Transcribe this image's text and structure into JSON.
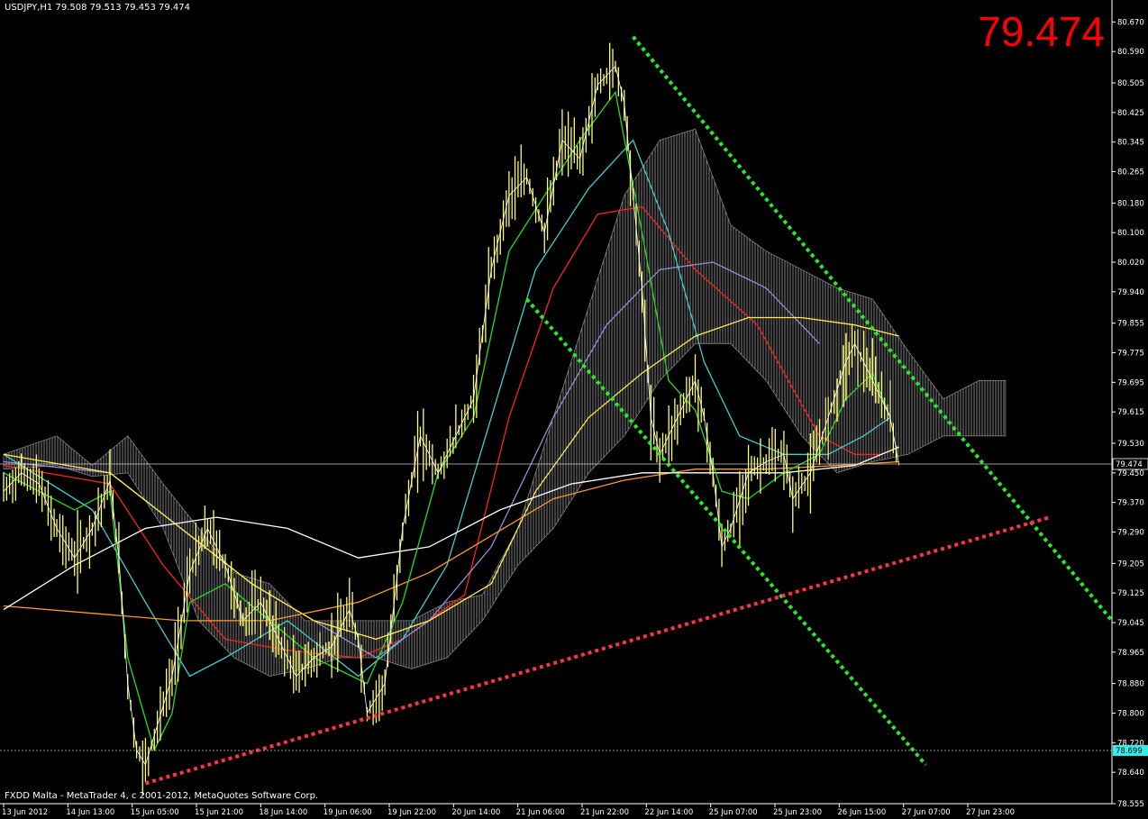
{
  "header": {
    "symbol_info": "USDJPY,H1  79.508 79.513 79.453 79.474",
    "big_price": "79.474",
    "copyright": "FXDD Malta - MetaTrader 4, c 2001-2012, MetaQuotes Software Corp."
  },
  "colors": {
    "background": "#000000",
    "candle": "#ffff66",
    "axis": "#ffffff",
    "trend_green": "#22ee22",
    "trend_red": "#ff3344",
    "big_price": "#ff0000",
    "ma_red": "#ff2020",
    "ma_blue": "#9a8ad8",
    "ma_cyan": "#3cd0d0",
    "ma_yellow": "#ffee44",
    "ma_orange": "#ff9a2a",
    "ma_white": "#ffffff",
    "ma_green": "#22dd22",
    "cloud": "#9a9a9a",
    "price_marker_bg": "#33eeee"
  },
  "chart_data": {
    "type": "line",
    "title": "USDJPY,H1",
    "y_axis_position": "right",
    "ylim": [
      78.555,
      80.705
    ],
    "y_ticks": [
      "80.670",
      "80.590",
      "80.505",
      "80.425",
      "80.345",
      "80.265",
      "80.180",
      "80.100",
      "80.020",
      "79.940",
      "79.855",
      "79.775",
      "79.695",
      "79.615",
      "79.530",
      "79.450",
      "79.370",
      "79.290",
      "79.205",
      "79.125",
      "79.045",
      "78.965",
      "78.880",
      "78.800",
      "78.720",
      "78.640",
      "78.555"
    ],
    "x_ticks": [
      "13 Jun 2012",
      "14 Jun 13:00",
      "15 Jun 05:00",
      "15 Jun 21:00",
      "18 Jun 14:00",
      "19 Jun 06:00",
      "19 Jun 22:00",
      "20 Jun 14:00",
      "21 Jun 06:00",
      "21 Jun 22:00",
      "22 Jun 14:00",
      "25 Jun 07:00",
      "25 Jun 23:00",
      "26 Jun 15:00",
      "27 Jun 07:00",
      "27 Jun 23:00"
    ],
    "x_index_range": [
      0,
      125
    ],
    "current_price": {
      "value": 79.474,
      "label": "79.474"
    },
    "marker_price": {
      "value": 78.699,
      "label": "78.699"
    },
    "price_close": [
      {
        "i": 0,
        "v": 79.4
      },
      {
        "i": 2,
        "v": 79.45
      },
      {
        "i": 4,
        "v": 79.42
      },
      {
        "i": 6,
        "v": 79.3
      },
      {
        "i": 8,
        "v": 79.22
      },
      {
        "i": 10,
        "v": 79.3
      },
      {
        "i": 12,
        "v": 79.43
      },
      {
        "i": 13,
        "v": 79.22
      },
      {
        "i": 14,
        "v": 78.88
      },
      {
        "i": 15,
        "v": 78.7
      },
      {
        "i": 16,
        "v": 78.66
      },
      {
        "i": 17,
        "v": 78.74
      },
      {
        "i": 19,
        "v": 78.9
      },
      {
        "i": 21,
        "v": 79.18
      },
      {
        "i": 23,
        "v": 79.3
      },
      {
        "i": 25,
        "v": 79.2
      },
      {
        "i": 27,
        "v": 79.05
      },
      {
        "i": 29,
        "v": 79.1
      },
      {
        "i": 31,
        "v": 79.0
      },
      {
        "i": 33,
        "v": 78.9
      },
      {
        "i": 35,
        "v": 78.95
      },
      {
        "i": 37,
        "v": 78.98
      },
      {
        "i": 39,
        "v": 79.08
      },
      {
        "i": 40,
        "v": 79.0
      },
      {
        "i": 41,
        "v": 78.8
      },
      {
        "i": 43,
        "v": 78.88
      },
      {
        "i": 45,
        "v": 79.3
      },
      {
        "i": 47,
        "v": 79.55
      },
      {
        "i": 49,
        "v": 79.45
      },
      {
        "i": 51,
        "v": 79.55
      },
      {
        "i": 53,
        "v": 79.65
      },
      {
        "i": 55,
        "v": 80.0
      },
      {
        "i": 57,
        "v": 80.2
      },
      {
        "i": 59,
        "v": 80.25
      },
      {
        "i": 61,
        "v": 80.1
      },
      {
        "i": 63,
        "v": 80.35
      },
      {
        "i": 65,
        "v": 80.3
      },
      {
        "i": 67,
        "v": 80.5
      },
      {
        "i": 69,
        "v": 80.55
      },
      {
        "i": 70,
        "v": 80.45
      },
      {
        "i": 71,
        "v": 80.2
      },
      {
        "i": 72,
        "v": 79.95
      },
      {
        "i": 73,
        "v": 79.6
      },
      {
        "i": 74,
        "v": 79.5
      },
      {
        "i": 76,
        "v": 79.6
      },
      {
        "i": 78,
        "v": 79.7
      },
      {
        "i": 79,
        "v": 79.6
      },
      {
        "i": 80,
        "v": 79.45
      },
      {
        "i": 81,
        "v": 79.25
      },
      {
        "i": 82,
        "v": 79.3
      },
      {
        "i": 84,
        "v": 79.45
      },
      {
        "i": 86,
        "v": 79.48
      },
      {
        "i": 88,
        "v": 79.5
      },
      {
        "i": 89,
        "v": 79.38
      },
      {
        "i": 91,
        "v": 79.45
      },
      {
        "i": 93,
        "v": 79.6
      },
      {
        "i": 95,
        "v": 79.75
      },
      {
        "i": 96,
        "v": 79.8
      },
      {
        "i": 98,
        "v": 79.7
      },
      {
        "i": 100,
        "v": 79.6
      },
      {
        "i": 101,
        "v": 79.47
      }
    ],
    "moving_averages": [
      {
        "color": "ma_red",
        "points": [
          {
            "i": 0,
            "v": 79.47
          },
          {
            "i": 12,
            "v": 79.42
          },
          {
            "i": 18,
            "v": 79.2
          },
          {
            "i": 25,
            "v": 79.0
          },
          {
            "i": 32,
            "v": 78.97
          },
          {
            "i": 40,
            "v": 78.95
          },
          {
            "i": 45,
            "v": 79.0
          },
          {
            "i": 52,
            "v": 79.12
          },
          {
            "i": 57,
            "v": 79.6
          },
          {
            "i": 62,
            "v": 79.95
          },
          {
            "i": 67,
            "v": 80.15
          },
          {
            "i": 72,
            "v": 80.17
          },
          {
            "i": 78,
            "v": 80.0
          },
          {
            "i": 85,
            "v": 79.85
          },
          {
            "i": 92,
            "v": 79.55
          },
          {
            "i": 96,
            "v": 79.5
          },
          {
            "i": 99,
            "v": 79.5
          }
        ]
      },
      {
        "color": "ma_blue",
        "points": [
          {
            "i": 0,
            "v": 79.48
          },
          {
            "i": 12,
            "v": 79.45
          },
          {
            "i": 20,
            "v": 79.3
          },
          {
            "i": 28,
            "v": 79.15
          },
          {
            "i": 35,
            "v": 79.05
          },
          {
            "i": 42,
            "v": 78.95
          },
          {
            "i": 48,
            "v": 79.05
          },
          {
            "i": 55,
            "v": 79.25
          },
          {
            "i": 62,
            "v": 79.6
          },
          {
            "i": 68,
            "v": 79.85
          },
          {
            "i": 74,
            "v": 80.0
          },
          {
            "i": 80,
            "v": 80.02
          },
          {
            "i": 86,
            "v": 79.95
          },
          {
            "i": 92,
            "v": 79.8
          }
        ]
      },
      {
        "color": "ma_cyan",
        "points": [
          {
            "i": 0,
            "v": 79.5
          },
          {
            "i": 10,
            "v": 79.35
          },
          {
            "i": 16,
            "v": 79.1
          },
          {
            "i": 21,
            "v": 78.9
          },
          {
            "i": 25,
            "v": 78.95
          },
          {
            "i": 32,
            "v": 79.05
          },
          {
            "i": 40,
            "v": 78.9
          },
          {
            "i": 45,
            "v": 79.0
          },
          {
            "i": 50,
            "v": 79.2
          },
          {
            "i": 55,
            "v": 79.6
          },
          {
            "i": 60,
            "v": 80.0
          },
          {
            "i": 66,
            "v": 80.22
          },
          {
            "i": 71,
            "v": 80.35
          },
          {
            "i": 75,
            "v": 80.1
          },
          {
            "i": 79,
            "v": 79.75
          },
          {
            "i": 83,
            "v": 79.55
          },
          {
            "i": 88,
            "v": 79.5
          },
          {
            "i": 93,
            "v": 79.5
          },
          {
            "i": 97,
            "v": 79.55
          },
          {
            "i": 100,
            "v": 79.6
          }
        ]
      },
      {
        "color": "ma_yellow",
        "points": [
          {
            "i": 0,
            "v": 79.5
          },
          {
            "i": 12,
            "v": 79.45
          },
          {
            "i": 20,
            "v": 79.3
          },
          {
            "i": 28,
            "v": 79.15
          },
          {
            "i": 35,
            "v": 79.05
          },
          {
            "i": 42,
            "v": 79.0
          },
          {
            "i": 48,
            "v": 79.05
          },
          {
            "i": 55,
            "v": 79.15
          },
          {
            "i": 60,
            "v": 79.4
          },
          {
            "i": 66,
            "v": 79.6
          },
          {
            "i": 72,
            "v": 79.72
          },
          {
            "i": 78,
            "v": 79.82
          },
          {
            "i": 84,
            "v": 79.87
          },
          {
            "i": 90,
            "v": 79.87
          },
          {
            "i": 96,
            "v": 79.85
          },
          {
            "i": 101,
            "v": 79.82
          }
        ]
      },
      {
        "color": "ma_orange",
        "points": [
          {
            "i": 0,
            "v": 79.09
          },
          {
            "i": 10,
            "v": 79.07
          },
          {
            "i": 20,
            "v": 79.05
          },
          {
            "i": 30,
            "v": 79.05
          },
          {
            "i": 40,
            "v": 79.1
          },
          {
            "i": 48,
            "v": 79.18
          },
          {
            "i": 55,
            "v": 79.28
          },
          {
            "i": 62,
            "v": 79.38
          },
          {
            "i": 70,
            "v": 79.43
          },
          {
            "i": 78,
            "v": 79.46
          },
          {
            "i": 86,
            "v": 79.46
          },
          {
            "i": 94,
            "v": 79.47
          },
          {
            "i": 101,
            "v": 79.48
          }
        ]
      },
      {
        "color": "ma_white",
        "points": [
          {
            "i": 0,
            "v": 79.08
          },
          {
            "i": 8,
            "v": 79.2
          },
          {
            "i": 16,
            "v": 79.3
          },
          {
            "i": 24,
            "v": 79.33
          },
          {
            "i": 32,
            "v": 79.3
          },
          {
            "i": 40,
            "v": 79.22
          },
          {
            "i": 48,
            "v": 79.25
          },
          {
            "i": 56,
            "v": 79.35
          },
          {
            "i": 64,
            "v": 79.42
          },
          {
            "i": 72,
            "v": 79.45
          },
          {
            "i": 80,
            "v": 79.45
          },
          {
            "i": 88,
            "v": 79.45
          },
          {
            "i": 96,
            "v": 79.47
          },
          {
            "i": 101,
            "v": 79.52
          }
        ]
      },
      {
        "color": "ma_green",
        "points": [
          {
            "i": 0,
            "v": 79.45
          },
          {
            "i": 8,
            "v": 79.35
          },
          {
            "i": 12,
            "v": 79.4
          },
          {
            "i": 14,
            "v": 78.95
          },
          {
            "i": 17,
            "v": 78.7
          },
          {
            "i": 19,
            "v": 78.8
          },
          {
            "i": 21,
            "v": 79.1
          },
          {
            "i": 25,
            "v": 79.15
          },
          {
            "i": 30,
            "v": 79.05
          },
          {
            "i": 35,
            "v": 78.95
          },
          {
            "i": 41,
            "v": 78.88
          },
          {
            "i": 45,
            "v": 79.1
          },
          {
            "i": 49,
            "v": 79.45
          },
          {
            "i": 53,
            "v": 79.6
          },
          {
            "i": 57,
            "v": 80.05
          },
          {
            "i": 61,
            "v": 80.2
          },
          {
            "i": 65,
            "v": 80.35
          },
          {
            "i": 69,
            "v": 80.48
          },
          {
            "i": 72,
            "v": 80.1
          },
          {
            "i": 75,
            "v": 79.7
          },
          {
            "i": 78,
            "v": 79.62
          },
          {
            "i": 81,
            "v": 79.4
          },
          {
            "i": 84,
            "v": 79.38
          },
          {
            "i": 88,
            "v": 79.45
          },
          {
            "i": 92,
            "v": 79.5
          },
          {
            "i": 95,
            "v": 79.65
          },
          {
            "i": 98,
            "v": 79.72
          },
          {
            "i": 100,
            "v": 79.6
          }
        ]
      }
    ],
    "ichimoku_cloud": [
      {
        "i": 0,
        "top": 79.5,
        "bottom": 79.46
      },
      {
        "i": 6,
        "top": 79.55,
        "bottom": 79.47
      },
      {
        "i": 10,
        "top": 79.47,
        "bottom": 79.44
      },
      {
        "i": 14,
        "top": 79.55,
        "bottom": 79.45
      },
      {
        "i": 18,
        "top": 79.42,
        "bottom": 79.3
      },
      {
        "i": 22,
        "top": 79.3,
        "bottom": 79.05
      },
      {
        "i": 26,
        "top": 79.18,
        "bottom": 78.95
      },
      {
        "i": 30,
        "top": 79.15,
        "bottom": 78.9
      },
      {
        "i": 34,
        "top": 79.05,
        "bottom": 78.92
      },
      {
        "i": 38,
        "top": 79.05,
        "bottom": 78.95
      },
      {
        "i": 42,
        "top": 79.05,
        "bottom": 78.95
      },
      {
        "i": 46,
        "top": 79.05,
        "bottom": 78.92
      },
      {
        "i": 50,
        "top": 79.1,
        "bottom": 78.95
      },
      {
        "i": 54,
        "top": 79.12,
        "bottom": 79.05
      },
      {
        "i": 58,
        "top": 79.3,
        "bottom": 79.2
      },
      {
        "i": 62,
        "top": 79.6,
        "bottom": 79.3
      },
      {
        "i": 66,
        "top": 79.9,
        "bottom": 79.45
      },
      {
        "i": 70,
        "top": 80.2,
        "bottom": 79.55
      },
      {
        "i": 74,
        "top": 80.35,
        "bottom": 79.7
      },
      {
        "i": 78,
        "top": 80.38,
        "bottom": 79.8
      },
      {
        "i": 82,
        "top": 80.12,
        "bottom": 79.8
      },
      {
        "i": 86,
        "top": 80.05,
        "bottom": 79.7
      },
      {
        "i": 90,
        "top": 80.0,
        "bottom": 79.55
      },
      {
        "i": 94,
        "top": 79.95,
        "bottom": 79.45
      },
      {
        "i": 98,
        "top": 79.92,
        "bottom": 79.48
      },
      {
        "i": 102,
        "top": 79.78,
        "bottom": 79.5
      },
      {
        "i": 106,
        "top": 79.65,
        "bottom": 79.55
      },
      {
        "i": 110,
        "top": 79.7,
        "bottom": 79.55
      },
      {
        "i": 113,
        "top": 79.7,
        "bottom": 79.55
      }
    ],
    "trendlines": [
      {
        "name": "down-channel-upper",
        "color": "trend_green",
        "style": "dotted",
        "from": {
          "i": 71,
          "v": 80.63
        },
        "to": {
          "i": 125,
          "v": 79.05
        }
      },
      {
        "name": "down-channel-lower",
        "color": "trend_green",
        "style": "dotted",
        "from": {
          "i": 59,
          "v": 79.92
        },
        "to": {
          "i": 104,
          "v": 78.66
        }
      },
      {
        "name": "support-line",
        "color": "trend_red",
        "style": "dotted",
        "from": {
          "i": 16,
          "v": 78.61
        },
        "to": {
          "i": 118,
          "v": 79.33
        }
      }
    ]
  }
}
